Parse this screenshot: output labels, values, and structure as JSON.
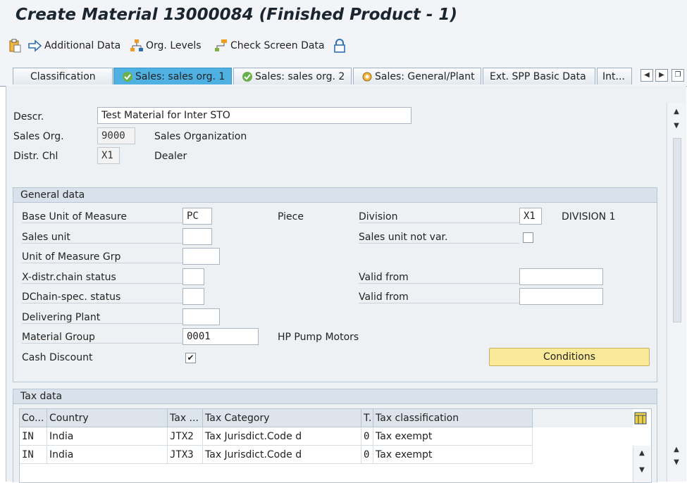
{
  "window": {
    "title": "Create Material 13000084 (Finished Product - 1)"
  },
  "toolbar": {
    "additional_data": "Additional Data",
    "org_levels": "Org. Levels",
    "check_screen_data": "Check Screen Data"
  },
  "tabs": [
    {
      "label": "Classification"
    },
    {
      "label": "Sales: sales org. 1"
    },
    {
      "label": "Sales: sales org. 2"
    },
    {
      "label": "Sales: General/Plant"
    },
    {
      "label": "Ext. SPP Basic Data"
    },
    {
      "label": "Int..."
    }
  ],
  "header": {
    "descr_label": "Descr.",
    "descr_value": "Test Material for Inter STO",
    "sales_org_label": "Sales Org.",
    "sales_org_value": "9000",
    "sales_org_text": "Sales Organization",
    "distr_chl_label": "Distr. Chl",
    "distr_chl_value": "X1",
    "distr_chl_text": "Dealer"
  },
  "general": {
    "title": "General data",
    "base_uom_label": "Base Unit of Measure",
    "base_uom_value": "PC",
    "base_uom_text": "Piece",
    "division_label": "Division",
    "division_value": "X1",
    "division_text": "DIVISION 1",
    "sales_unit_label": "Sales unit",
    "sales_unit_not_var_label": "Sales unit not var.",
    "uom_grp_label": "Unit of Measure Grp",
    "xdistr_label": "X-distr.chain status",
    "valid_from_label_1": "Valid from",
    "dchain_label": "DChain-spec. status",
    "valid_from_label_2": "Valid from",
    "delivering_plant_label": "Delivering Plant",
    "material_group_label": "Material Group",
    "material_group_value": "0001",
    "material_group_text": "HP Pump Motors",
    "cash_discount_label": "Cash Discount",
    "cash_discount_checked": true,
    "conditions_button": "Conditions"
  },
  "tax": {
    "title": "Tax data",
    "columns": [
      "Co...",
      "Country",
      "Tax ...",
      "Tax Category",
      "T.",
      "Tax classification"
    ],
    "rows": [
      [
        "IN",
        "India",
        "JTX2",
        "Tax Jurisdict.Code d",
        "0",
        "Tax exempt"
      ],
      [
        "IN",
        "India",
        "JTX3",
        "Tax Jurisdict.Code d",
        "0",
        "Tax exempt"
      ]
    ]
  },
  "colors": {
    "active_tab": "#4fb0e2",
    "button": "#fbe99a",
    "group_header": "#d9e1ea"
  }
}
